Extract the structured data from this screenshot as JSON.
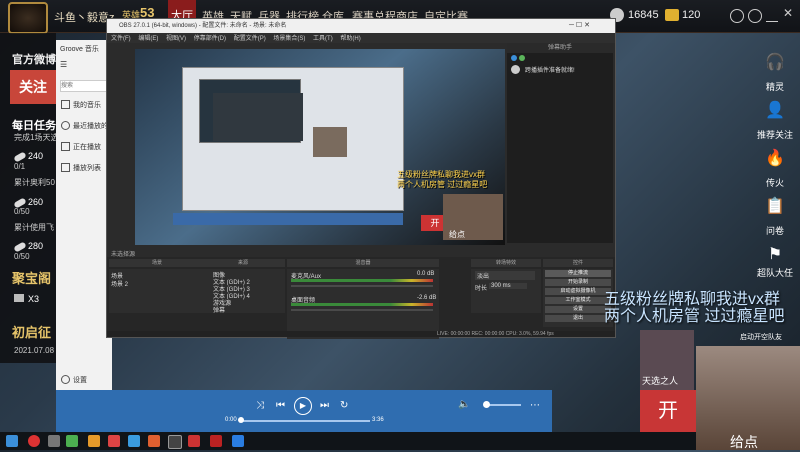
{
  "game_bar": {
    "username": "斗鱼丶毅意z",
    "level_badge": "英雄",
    "level": "53",
    "tabs": [
      "大厅",
      "英雄",
      "天赋",
      "兵器",
      "排行榜",
      "仓库",
      "赛事总程",
      "商店",
      "自定比赛"
    ],
    "coins": "16845",
    "gold": "120"
  },
  "left_panel": {
    "official_label": "官方微博:",
    "follow_label": "关注",
    "daily_label": "每日任务",
    "tasks": [
      {
        "text": "完成1场天选",
        "value": "240",
        "count": "0/1"
      },
      {
        "text": "累计奥利50",
        "value": "260",
        "count": "0/50"
      },
      {
        "text": "累计使用飞",
        "value": "280",
        "count": "0/50"
      }
    ],
    "treasure_label": "聚宝阁",
    "treasure_count": "X3",
    "event_label": "初启征",
    "event_date": "2021.07.08"
  },
  "groove": {
    "title": "Groove 音乐",
    "search_placeholder": "搜索",
    "items": [
      "我的音乐",
      "最近播放的内容",
      "正在播放",
      "播放列表"
    ],
    "settings": "设置"
  },
  "obs": {
    "title": "OBS 27.0.1 (64-bit, windows) - 配置文件: 未命名 - 场景: 未命名",
    "menu": [
      "文件(F)",
      "编辑(E)",
      "视图(V)",
      "停靠部件(D)",
      "配置文件(P)",
      "场景集合(S)",
      "工具(T)",
      "帮助(H)"
    ],
    "chat_header": "弹幕助手",
    "chat_message": "跨播插件准备就绪!",
    "overlay_line1": "五级粉丝牌私聊我进vx群",
    "overlay_line2": "两个人机房管 过过瘾星吧",
    "overlay_open": "开",
    "overlay_give": "给点",
    "scene_tag": "未选择源",
    "panel_headers": [
      "场景",
      "来源",
      "混音器",
      "转场特效",
      "控件"
    ],
    "scenes": [
      "场景",
      "场景 2"
    ],
    "sources": [
      "图像",
      "文本 (GDI+) 2",
      "文本 (GDI+) 3",
      "文本 (GDI+) 4",
      "游戏源",
      "弹幕"
    ],
    "mixer": [
      {
        "label": "麦克风/Aux",
        "db": "0.0 dB"
      },
      {
        "label": "桌面音频",
        "db": "-2.6 dB"
      }
    ],
    "transition": {
      "type": "淡出",
      "duration_label": "时长",
      "duration": "300 ms"
    },
    "controls": [
      "停止推流",
      "开始录制",
      "启动虚拟摄像机",
      "工作室模式",
      "设置",
      "退出"
    ],
    "status": "LIVE: 00:00:00   REC: 00:00:00   CPU: 3.0%, 59.94 fps"
  },
  "player": {
    "time_start": "0:00",
    "time_end": "3:36"
  },
  "right_panel": {
    "items": [
      "精灵",
      "推荐关注",
      "传火",
      "问卷",
      "超队大任"
    ]
  },
  "overlays": {
    "banner_line1": "五级粉丝牌私聊我进vx群",
    "banner_line2": "两个人机房管 过过瘾星吧",
    "user_label": "天选之人",
    "team_label": "启动开空队友",
    "open_label": "开",
    "give_label": "给点"
  }
}
